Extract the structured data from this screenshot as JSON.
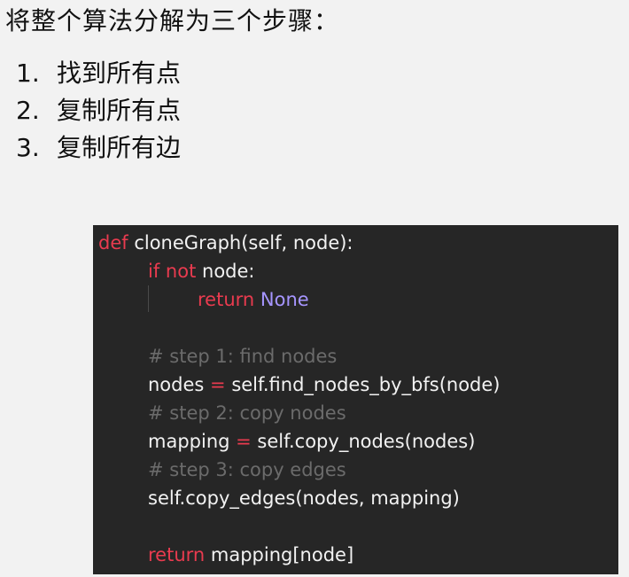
{
  "heading": "将整个算法分解为三个步骤：",
  "steps": [
    {
      "number": "1.",
      "text": "找到所有点"
    },
    {
      "number": "2.",
      "text": "复制所有点"
    },
    {
      "number": "3.",
      "text": "复制所有边"
    }
  ],
  "code": {
    "def_kw": "def",
    "func_sig": " cloneGraph(self, node):",
    "if_kw": "if",
    "not_kw": "not",
    "if_rest": " node:",
    "return_kw": "return",
    "none_const": "None",
    "comment_step1": "# step 1: find nodes",
    "nodes_var": "nodes ",
    "assign_op": "=",
    "find_call": " self.find_nodes_by_bfs(node)",
    "comment_step2": "# step 2: copy nodes",
    "mapping_var": "mapping ",
    "copy_nodes_call": " self.copy_nodes(nodes)",
    "comment_step3": "# step 3: copy edges",
    "copy_edges_call": "self.copy_edges(nodes, mapping)",
    "final_return_kw": "return",
    "final_return_rest": " mapping[node]"
  },
  "colors": {
    "code_background": "#262626",
    "keyword": "#e93b4f",
    "constant": "#a695ff",
    "comment": "#6b6b6b",
    "code_text": "#f2f2f2",
    "page_background": "#f2f2f2"
  }
}
